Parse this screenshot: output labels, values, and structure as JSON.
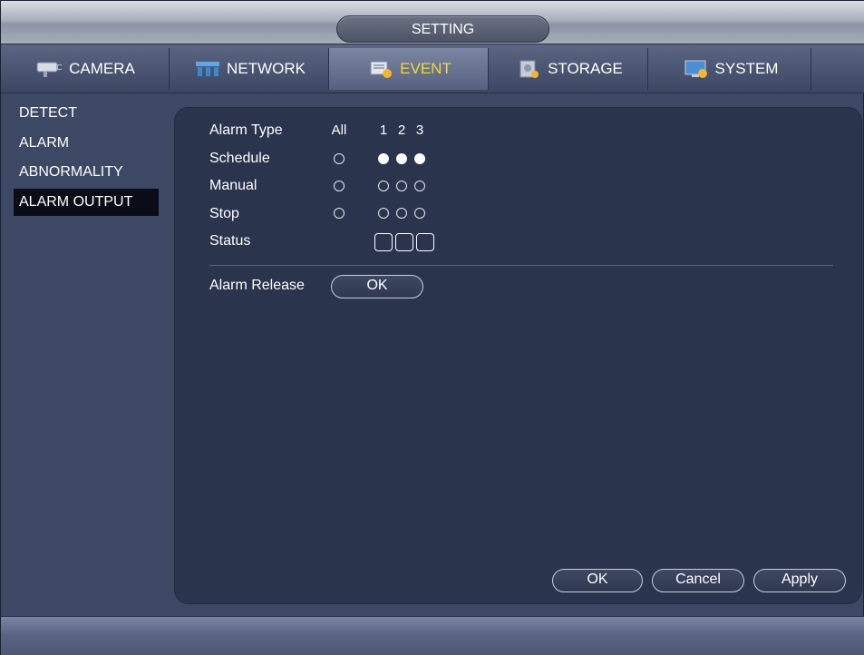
{
  "header": {
    "title": "SETTING"
  },
  "tabs": [
    {
      "label": "CAMERA",
      "icon": "camera-icon",
      "active": false
    },
    {
      "label": "NETWORK",
      "icon": "network-icon",
      "active": false
    },
    {
      "label": "EVENT",
      "icon": "event-icon",
      "active": true
    },
    {
      "label": "STORAGE",
      "icon": "storage-icon",
      "active": false
    },
    {
      "label": "SYSTEM",
      "icon": "system-icon",
      "active": false
    }
  ],
  "sidebar": {
    "items": [
      {
        "label": "DETECT",
        "active": false
      },
      {
        "label": "ALARM",
        "active": false
      },
      {
        "label": "ABNORMALITY",
        "active": false
      },
      {
        "label": "ALARM OUTPUT",
        "active": true
      }
    ]
  },
  "alarm_output": {
    "alarm_type_label": "Alarm Type",
    "all_label": "All",
    "channels": [
      "1",
      "2",
      "3"
    ],
    "schedule_label": "Schedule",
    "manual_label": "Manual",
    "stop_label": "Stop",
    "status_label": "Status",
    "selected_mode": "Schedule",
    "alarm_release_label": "Alarm Release",
    "alarm_release_button": "OK"
  },
  "footer": {
    "ok_label": "OK",
    "cancel_label": "Cancel",
    "apply_label": "Apply"
  },
  "colors": {
    "active_tab_text": "#f5d63a",
    "panel_bg": "#2b344d",
    "frame_bg": "#3d4865"
  }
}
